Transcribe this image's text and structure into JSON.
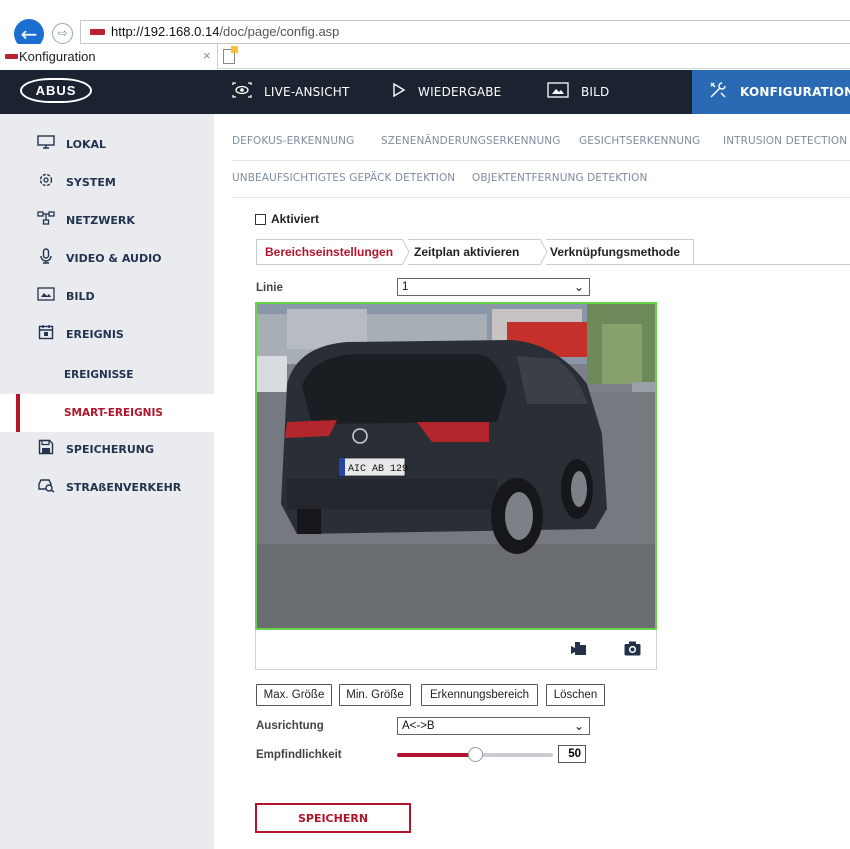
{
  "browser": {
    "url_host": "http://192.168.0.14",
    "url_path": "/doc/page/config.asp",
    "tab_title": "Konfiguration",
    "tab_close": "×"
  },
  "header": {
    "logo": "ABUS",
    "nav": [
      {
        "label": "LIVE-ANSICHT",
        "icon": "eye-icon"
      },
      {
        "label": "WIEDERGABE",
        "icon": "play-icon"
      },
      {
        "label": "BILD",
        "icon": "image-icon"
      },
      {
        "label": "KONFIGURATION",
        "icon": "tools-icon",
        "active": true
      }
    ]
  },
  "sidebar": {
    "items": [
      {
        "label": "LOKAL",
        "icon": "monitor-icon"
      },
      {
        "label": "SYSTEM",
        "icon": "gear-icon"
      },
      {
        "label": "NETZWERK",
        "icon": "network-icon"
      },
      {
        "label": "VIDEO & AUDIO",
        "icon": "microphone-icon"
      },
      {
        "label": "BILD",
        "icon": "image-icon"
      },
      {
        "label": "EREIGNIS",
        "icon": "calendar-icon"
      },
      {
        "label": "EREIGNISSE",
        "sub": true
      },
      {
        "label": "SMART-EREIGNIS",
        "sub": true,
        "active": true
      },
      {
        "label": "SPEICHERUNG",
        "icon": "save-icon"
      },
      {
        "label": "STRAßENVERKEHR",
        "icon": "car-search-icon"
      }
    ]
  },
  "subtabs": {
    "row1": [
      "DEFOKUS-ERKENNUNG",
      "SZENENÄNDERUNGSERKENNUNG",
      "GESICHTSERKENNUNG",
      "INTRUSION DETECTION"
    ],
    "row2": [
      "UNBEAUFSICHTIGTES GEPÄCK DETEKTION",
      "OBJEKTENTFERNUNG DETEKTION"
    ]
  },
  "form": {
    "enabled_label": "Aktiviert",
    "enabled": false,
    "inner_tabs": [
      "Bereichseinstellungen",
      "Zeitplan aktivieren",
      "Verknüpfungsmethode"
    ],
    "line_label": "Linie",
    "line_value": "1",
    "license_plate": "AIC AB 129",
    "buttons": [
      "Max. Größe",
      "Min. Größe",
      "Erkennungsbereich",
      "Löschen"
    ],
    "direction_label": "Ausrichtung",
    "direction_value": "A<->B",
    "sensitivity_label": "Empfindlichkeit",
    "sensitivity_value": "50",
    "sensitivity_level": 0.5,
    "save_label": "SPEICHERN"
  },
  "colors": {
    "accent_red": "#b0152c",
    "nav_dark": "#1c2330",
    "nav_active": "#2a6ab4",
    "video_border": "#69d44a"
  }
}
